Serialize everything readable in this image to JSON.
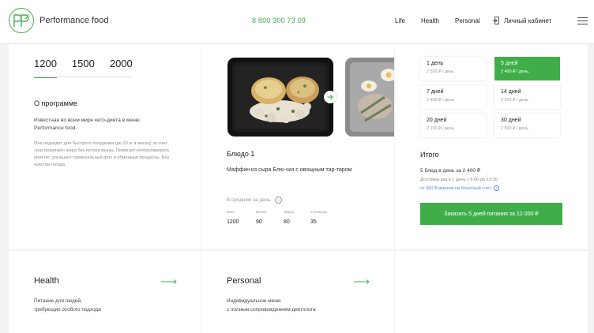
{
  "header": {
    "brand": "Performance food",
    "phone": "8 800 300 73 09",
    "nav": [
      "Life",
      "Health",
      "Personal"
    ],
    "cabinet": "Личный кабинет",
    "accent": "#3fae49"
  },
  "program": {
    "calories": [
      "1200",
      "1500",
      "2000"
    ],
    "active_calorie": "1200",
    "title": "О программе",
    "lead": "Известная во всем мире кето-диета в меню Performance food.",
    "description": "Она подходит для быстрого похудения (до 10 кг в месяц) за счет «растворения» жира без потери мышц. Помогает контролировать аппетит, улучшает гормональный фон и обменные процессы. Без чувства голода"
  },
  "dish": {
    "name": "Блюдо 1",
    "description": "Маффин из сыра Блю-чиз с овощным тар-таром",
    "avg_label": "В среднем за день",
    "nutrients": [
      {
        "label": "ккал",
        "value": "1200"
      },
      {
        "label": "Белки",
        "value": "90"
      },
      {
        "label": "Жиры",
        "value": "80"
      },
      {
        "label": "Углеводы",
        "value": "35"
      }
    ]
  },
  "plans": [
    {
      "title": "1 день",
      "price": "2 500 ₽ / день"
    },
    {
      "title": "5 дней",
      "price": "2 400 ₽ / день.",
      "active": true
    },
    {
      "title": "7 дней",
      "price": "2 400 ₽ / день"
    },
    {
      "title": "14 дней",
      "price": "2 200 ₽ / день"
    },
    {
      "title": "20 дней",
      "price": "2 100 ₽ / день"
    },
    {
      "title": "30 дней",
      "price": "2 000 ₽ / день"
    }
  ],
  "total": {
    "title": "Итого",
    "line": "5 блюд в день за 2 400 ₽",
    "delivery": "Доставка раз в 1 день с 6:00 до 12:00",
    "bonus": "от 360 ₽ вернем на бонусный счет",
    "order_button": "Заказать 5 дней питания за 12 000 ₽"
  },
  "cards": [
    {
      "title": "Health",
      "text": [
        "Питание для людей,",
        "требующих особого подхода"
      ]
    },
    {
      "title": "Personal",
      "text": [
        "Индивидуальное меню",
        "с полным сопровождением диетолога"
      ]
    }
  ]
}
